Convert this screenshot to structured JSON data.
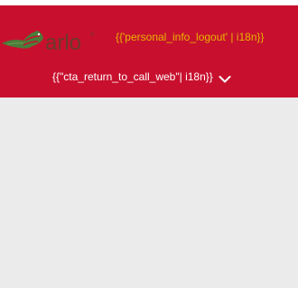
{
  "header": {
    "background_color": "#c8102e",
    "logo_text": "arlo",
    "logo_trademark": "®",
    "logout_label": "{{'personal_info_logout' | i18n}}",
    "logout_color": "#e8b300",
    "cta_label": "{{\"cta_return_to_call_web\"| i18n}}",
    "cta_icon": "chevron-down-icon"
  }
}
